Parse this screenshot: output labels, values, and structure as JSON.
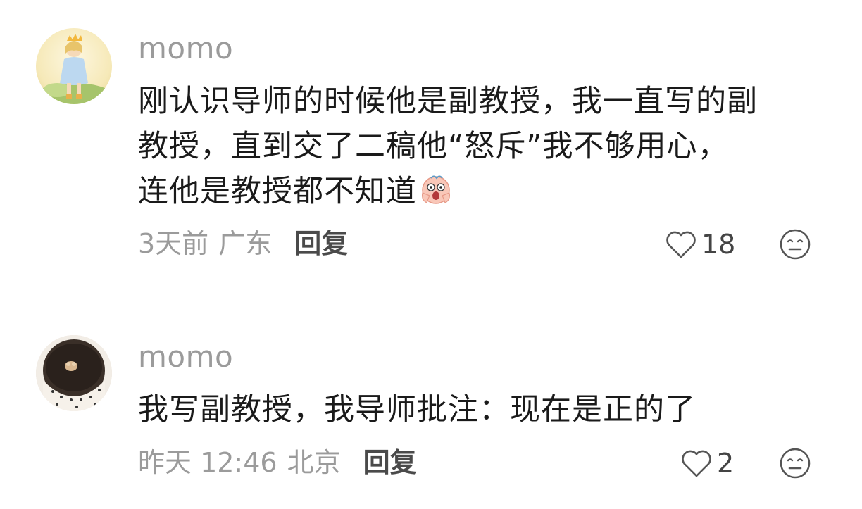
{
  "comments": [
    {
      "username": "momo",
      "text": "刚认识导师的时候他是副教授，我一直写的副教授，直到交了二稿他“怒斥”我不够用心，连他是教授都不知道",
      "lines": [
        "刚认识导师的时候他是副教授，我一直写的副",
        "教授，直到交了二稿他“怒斥”我不够用心，",
        "连他是教授都不知道"
      ],
      "emoji_icon": "screaming-face-emoji-icon",
      "time": "3天前",
      "location": "广东",
      "reply_label": "回复",
      "like_count": "18",
      "avatar_icon": "girl-avatar-icon"
    },
    {
      "username": "momo",
      "text": "我写副教授，我导师批注：现在是正的了",
      "time": "昨天 12:46",
      "location": "北京",
      "reply_label": "回复",
      "like_count": "2",
      "avatar_icon": "bowl-avatar-icon"
    }
  ],
  "icons": {
    "like": "heart-outline-icon",
    "react": "neutral-face-icon"
  },
  "colors": {
    "meta_gray": "#9b9b9b",
    "text_dark": "#1a1a1a",
    "reply": "#4a4a4a"
  }
}
